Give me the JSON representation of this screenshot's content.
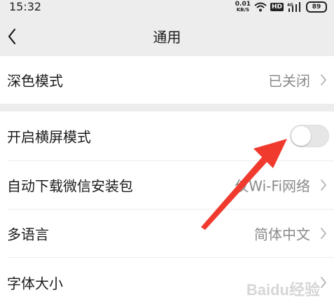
{
  "status_bar": {
    "time": "15:32",
    "net_speed": "0.01",
    "net_unit": "KB/S",
    "hd": "HD",
    "net_type": "4G",
    "battery": "89"
  },
  "nav": {
    "title": "通用",
    "back_icon": "chevron-left-icon"
  },
  "rows": [
    {
      "label": "深色模式",
      "value": "已关闭"
    },
    {
      "label": "开启横屏模式",
      "toggle_on": false
    },
    {
      "label": "自动下载微信安装包",
      "value": "仅Wi-Fi网络"
    },
    {
      "label": "多语言",
      "value": "简体中文"
    },
    {
      "label": "字体大小",
      "value": ""
    }
  ],
  "watermark": "Baidu经验",
  "colors": {
    "background": "#ededed",
    "annotation_arrow": "#f03a2e",
    "toggle_off": "#e6e6e6"
  }
}
